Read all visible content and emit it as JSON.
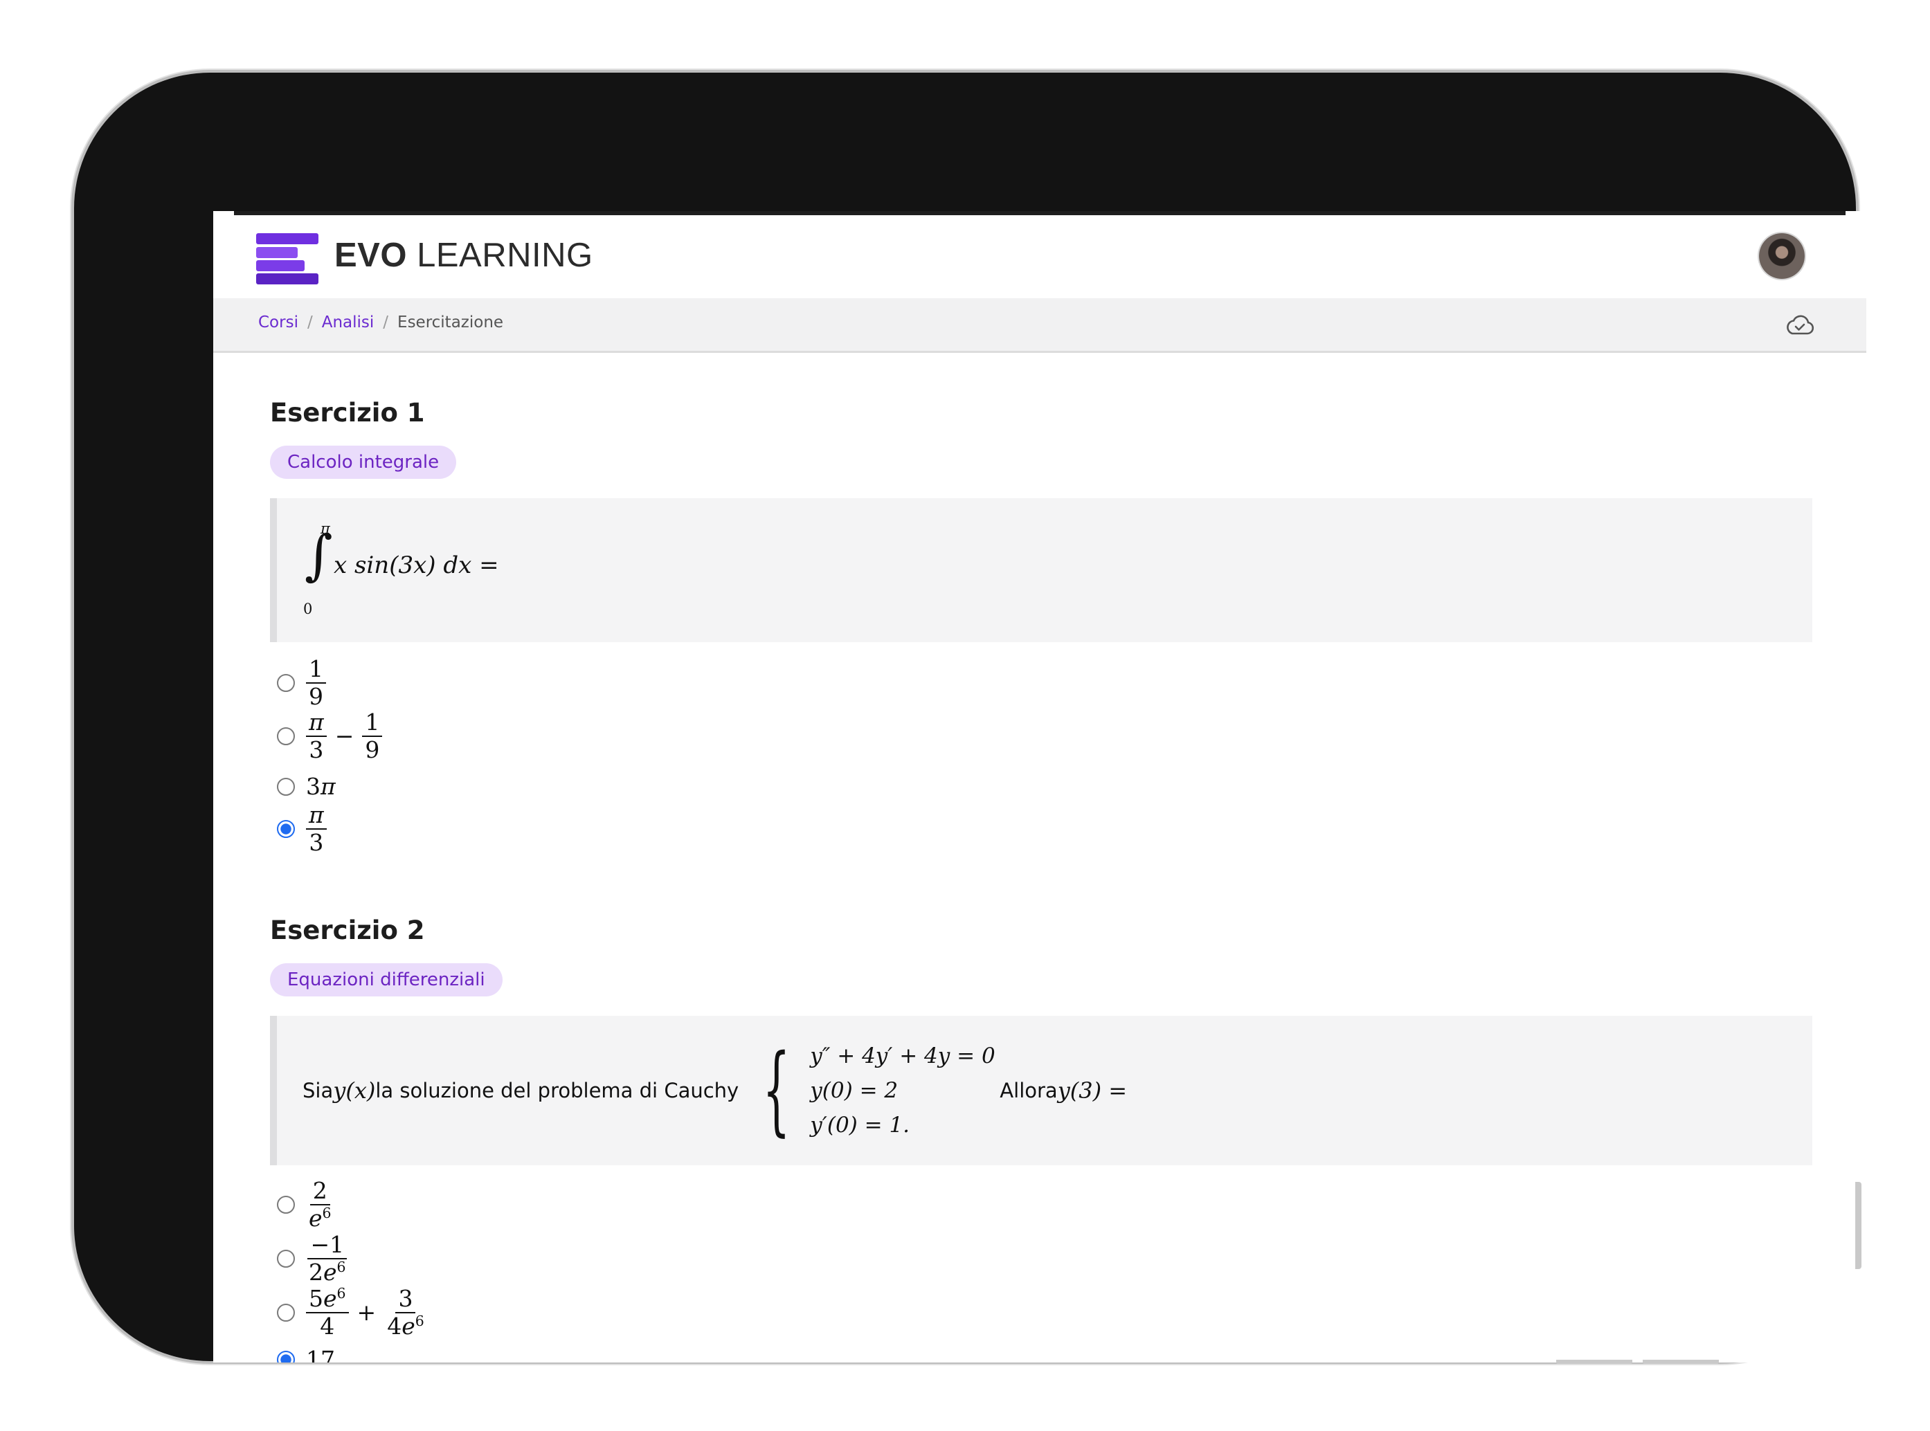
{
  "app": {
    "brand_bold": "EVO",
    "brand_light": " LEARNING"
  },
  "breadcrumb": {
    "items": [
      "Corsi",
      "Analisi",
      "Esercitazione"
    ]
  },
  "header_icons": {
    "save_status": "cloud-check-icon",
    "avatar": "avatar"
  },
  "colors": {
    "accent": "#6c24c2",
    "tag_bg": "#eadcfb",
    "radio_selected": "#1f6bf0"
  },
  "exercises": [
    {
      "title": "Esercizio 1",
      "tag": "Calcolo integrale",
      "question": {
        "upper_limit": "π",
        "lower_limit": "0",
        "integrand": "x sin(3x) dx ="
      },
      "options": [
        {
          "text": "1/9",
          "selected": false
        },
        {
          "text": "π/3 − 1/9",
          "selected": false
        },
        {
          "text": "3π",
          "selected": false
        },
        {
          "text": "π/3",
          "selected": true
        }
      ]
    },
    {
      "title": "Esercizio 2",
      "tag": "Equazioni differenziali",
      "question": {
        "prefix_a": "Sia ",
        "func": "y(x)",
        "prefix_b": " la soluzione del problema di Cauchy",
        "system": [
          "y″ + 4y′ + 4y = 0",
          "y(0) = 2",
          "y′(0) = 1."
        ],
        "suffix_a": "Allora ",
        "target": "y(3) ="
      },
      "options": [
        {
          "text": "2/e^6",
          "selected": false
        },
        {
          "text": "−1/(2e^6)",
          "selected": false
        },
        {
          "text": "5e^6/4 + 3/(4e^6)",
          "selected": false
        },
        {
          "text": "17",
          "selected": true
        }
      ]
    }
  ]
}
